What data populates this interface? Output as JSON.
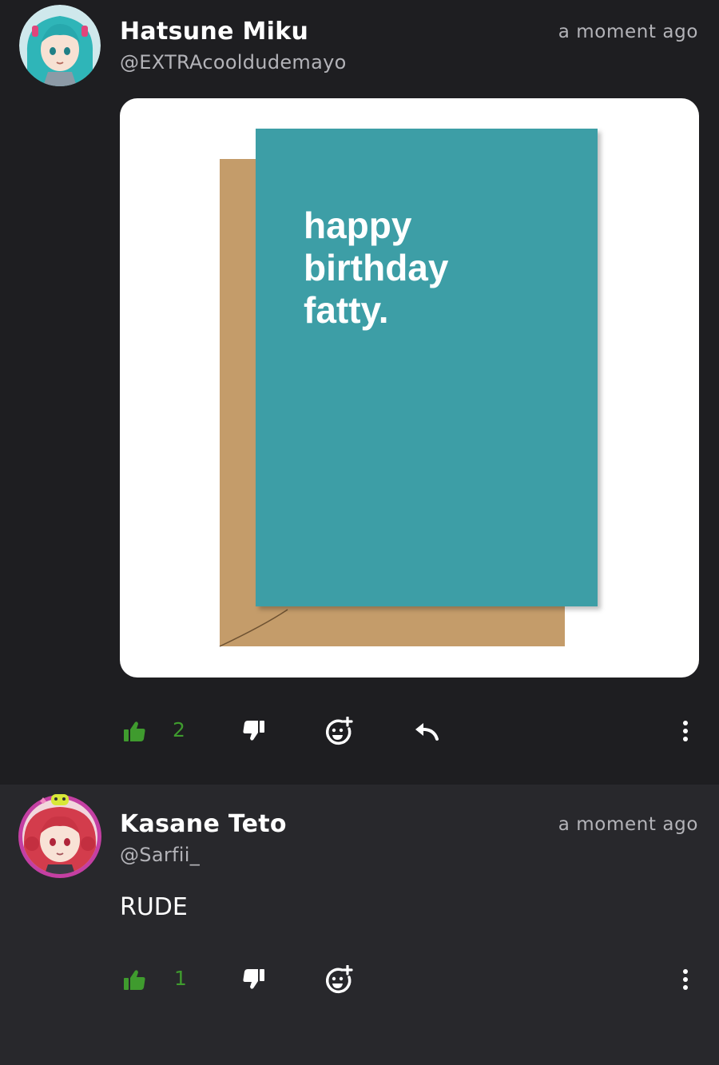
{
  "colors": {
    "background": "#1e1e21",
    "reply_background": "#28282c",
    "like_green": "#3f9b2e",
    "muted_text": "#b3b3b8",
    "card_teal": "#3e9ea6",
    "envelope_kraft": "#c49c6a"
  },
  "posts": [
    {
      "author": "Hatsune Miku",
      "handle": "@EXTRAcooldudemayo",
      "time": "a moment ago",
      "avatar_icon": "teal-hair-anime-avatar",
      "media": {
        "card_text": [
          "happy",
          "birthday",
          "fatty."
        ]
      },
      "actions": {
        "like_icon": "thumbs-up-icon",
        "like_count": "2",
        "dislike_icon": "thumbs-down-icon",
        "react_icon": "add-reaction-icon",
        "reply_icon": "reply-arrow-icon",
        "more_icon": "more-vertical-icon"
      }
    },
    {
      "author": "Kasane Teto",
      "handle": "@Sarfii_",
      "time": "a moment ago",
      "avatar_icon": "red-hair-anime-avatar",
      "text": "RUDE",
      "actions": {
        "like_icon": "thumbs-up-icon",
        "like_count": "1",
        "dislike_icon": "thumbs-down-icon",
        "react_icon": "add-reaction-icon",
        "more_icon": "more-vertical-icon"
      }
    }
  ]
}
